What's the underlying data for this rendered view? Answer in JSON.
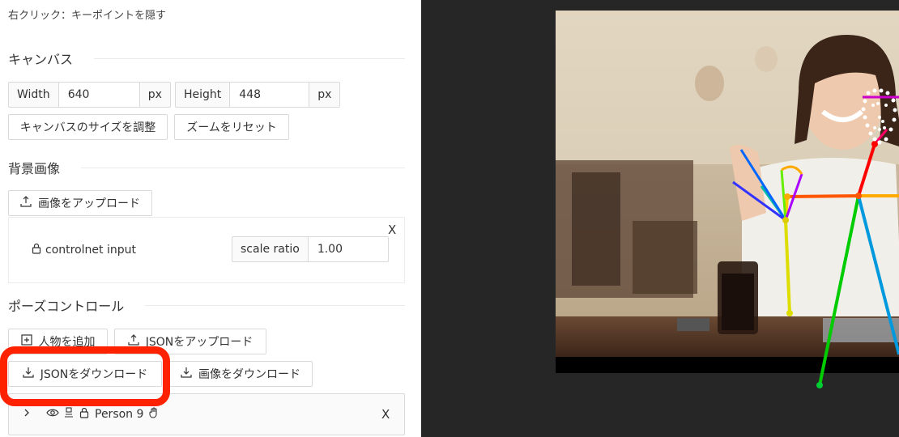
{
  "hint": "右クリック：キーポイントを隠す",
  "canvas": {
    "title": "キャンバス",
    "width_label": "Width",
    "width_value": "640",
    "height_label": "Height",
    "height_value": "448",
    "unit": "px",
    "resize_button": "キャンバスのサイズを調整",
    "reset_zoom_button": "ズームをリセット"
  },
  "background": {
    "title": "背景画像",
    "upload_button": "画像をアップロード",
    "item_name": "controlnet input",
    "scale_label": "scale ratio",
    "scale_value": "1.00",
    "close": "X"
  },
  "pose": {
    "title": "ポーズコントロール",
    "add_person_button": "人物を追加",
    "upload_json_button": "JSONをアップロード",
    "download_json_button": "JSONをダウンロード",
    "download_image_button": "画像をダウンロード",
    "person_label": "Person 9",
    "close": "X"
  },
  "icons": {
    "upload": "upload-icon",
    "download": "download-icon",
    "lock": "lock-icon",
    "eye": "eye-icon",
    "expand": "chevron-right-icon",
    "add": "plus-square-icon"
  },
  "colors": {
    "highlight": "#ff2200",
    "canvas_bg": "#262626"
  }
}
